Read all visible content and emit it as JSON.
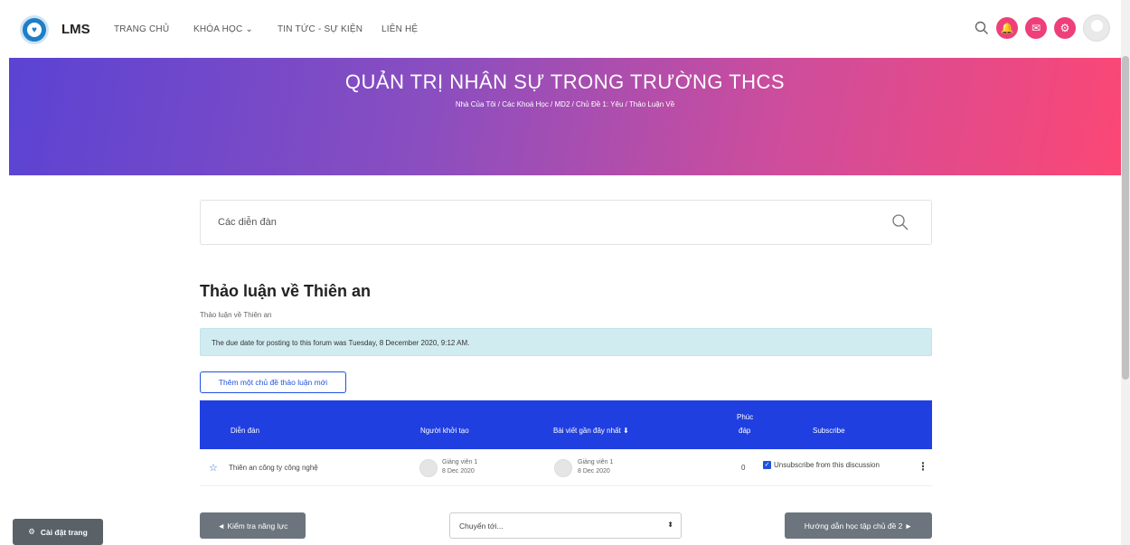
{
  "header": {
    "brand": "LMS",
    "logo_text": "LMS",
    "nav": [
      {
        "label": "TRANG CHỦ"
      },
      {
        "label": "KHÓA HỌC ⌄"
      },
      {
        "label": "TIN TỨC - SỰ KIỆN"
      },
      {
        "label": "LIÊN HỆ"
      }
    ]
  },
  "hero": {
    "title": "QUẢN TRỊ NHÂN SỰ TRONG TRƯỜNG THCS",
    "breadcrumb": "Nhà Của Tôi  /  Các Khoá Học  /  MD2  /  Chủ Đề 1: Yêu  /  Thảo Luận Về"
  },
  "search": {
    "placeholder": "Các diễn đàn"
  },
  "forum": {
    "title": "Thảo luận về Thiên an",
    "subtitle": "Thảo luận về Thiên an",
    "notice": "The due date for posting to this forum was Tuesday, 8 December 2020, 9:12 AM.",
    "add_button": "Thêm một chủ đề thảo luận mới"
  },
  "table": {
    "headers": {
      "discussion": "Diễn đàn",
      "started_by": "Người khởi tạo",
      "last_post": "Bài viết gần đây nhất ⬇",
      "replies_1": "Phúc",
      "replies_2": "đáp",
      "subscribe": "Subscribe"
    },
    "rows": [
      {
        "title": "Thiên an công ty công nghệ",
        "starter_name": "Giảng viên 1",
        "starter_date": "8 Dec 2020",
        "last_name": "Giảng viên 1",
        "last_date": "8 Dec 2020",
        "replies": "0",
        "subscribe_label": "Unsubscribe from this discussion",
        "kebab": "⋮"
      }
    ]
  },
  "footer": {
    "prev": "◄ Kiểm tra năng lực",
    "jump": "Chuyển tới...",
    "next": "Hướng dẫn học tập chủ đề 2 ►",
    "settings": "Cài đặt trang"
  },
  "colors": {
    "accent": "#1f3fe0",
    "pink": "#ee3f7a"
  }
}
